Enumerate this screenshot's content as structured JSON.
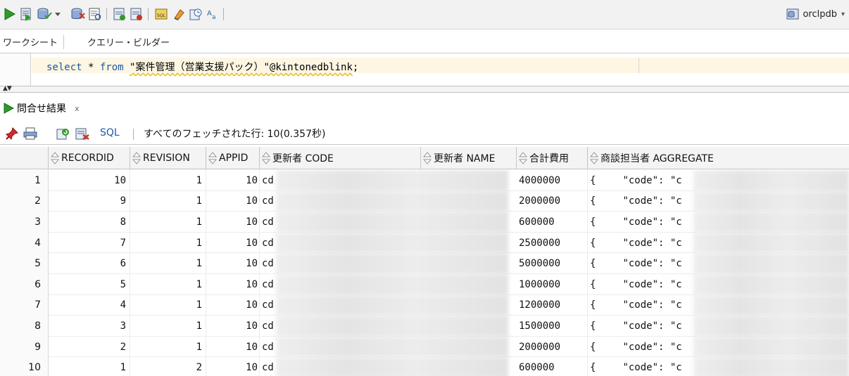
{
  "toolbar": {
    "buttons": [
      "run-statement-icon",
      "run-script-icon",
      "commit-icon",
      "rollback-icon",
      "explain-plan-icon",
      "autotrace-icon",
      "sql-tuning-icon",
      "clear-icon",
      "history-icon",
      "format-icon"
    ],
    "connection_label": "orclpdb"
  },
  "tabs": {
    "worksheet": "ワークシート",
    "query_builder": "クエリー・ビルダー"
  },
  "editor": {
    "kw_select": "select",
    "star": " * ",
    "kw_from": "from",
    "space": " ",
    "string_literal": "\"案件管理（営業支援パック）\"@kintonedblink",
    "terminator": ";"
  },
  "results": {
    "tab_label": "問合せ結果",
    "close_glyph": "x",
    "sql_label": "SQL",
    "status": "すべてのフェッチされた行: 10(0.357秒)"
  },
  "grid": {
    "columns": [
      "RECORDID",
      "REVISION",
      "APPID",
      "更新者 CODE",
      "更新者 NAME",
      "合計費用",
      "商談担当者 AGGREGATE"
    ],
    "rows": [
      {
        "n": "1",
        "recordid": "10",
        "revision": "1",
        "appid": "10",
        "code": "cd",
        "cost": "4000000",
        "agg_brace": "{",
        "agg": "\"code\": \"c"
      },
      {
        "n": "2",
        "recordid": "9",
        "revision": "1",
        "appid": "10",
        "code": "cd",
        "cost": "2000000",
        "agg_brace": "{",
        "agg": "\"code\": \"c"
      },
      {
        "n": "3",
        "recordid": "8",
        "revision": "1",
        "appid": "10",
        "code": "cd",
        "cost": "600000",
        "agg_brace": "{",
        "agg": "\"code\": \"c"
      },
      {
        "n": "4",
        "recordid": "7",
        "revision": "1",
        "appid": "10",
        "code": "cd",
        "cost": "2500000",
        "agg_brace": "{",
        "agg": "\"code\": \"c"
      },
      {
        "n": "5",
        "recordid": "6",
        "revision": "1",
        "appid": "10",
        "code": "cd",
        "cost": "5000000",
        "agg_brace": "{",
        "agg": "\"code\": \"c"
      },
      {
        "n": "6",
        "recordid": "5",
        "revision": "1",
        "appid": "10",
        "code": "cd",
        "cost": "1000000",
        "agg_brace": "{",
        "agg": "\"code\": \"c"
      },
      {
        "n": "7",
        "recordid": "4",
        "revision": "1",
        "appid": "10",
        "code": "cd",
        "cost": "1200000",
        "agg_brace": "{",
        "agg": "\"code\": \"c"
      },
      {
        "n": "8",
        "recordid": "3",
        "revision": "1",
        "appid": "10",
        "code": "cd",
        "cost": "1500000",
        "agg_brace": "{",
        "agg": "\"code\": \"c"
      },
      {
        "n": "9",
        "recordid": "2",
        "revision": "1",
        "appid": "10",
        "code": "cd",
        "cost": "2000000",
        "agg_brace": "{",
        "agg": "\"code\": \"c"
      },
      {
        "n": "10",
        "recordid": "1",
        "revision": "2",
        "appid": "10",
        "code": "cd",
        "cost": "600000",
        "agg_brace": "{",
        "agg": "\"code\": \"c"
      }
    ]
  }
}
